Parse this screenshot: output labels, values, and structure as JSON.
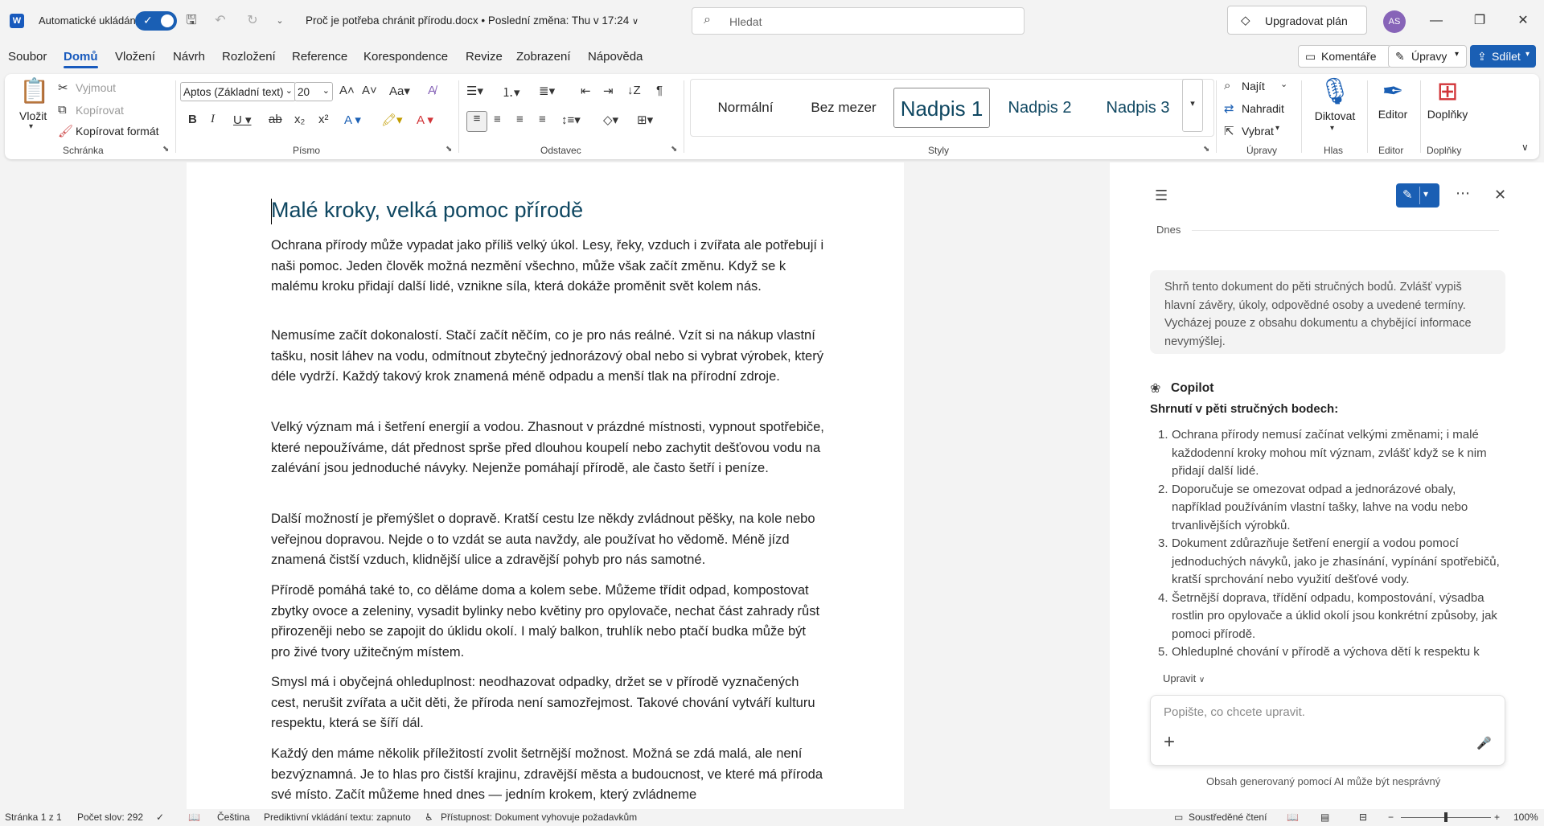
{
  "titlebar": {
    "autosave_label": "Automatické ukládání",
    "doc_title": "Proč je potřeba chránit přírodu.docx • Poslední změna: Thu v 17:24",
    "search_placeholder": "Hledat",
    "upgrade_label": "Upgradovat plán",
    "avatar_initials": "AS"
  },
  "menu": {
    "tabs": [
      "Soubor",
      "Domů",
      "Vložení",
      "Návrh",
      "Rozložení",
      "Reference",
      "Korespondence",
      "Revize",
      "Zobrazení",
      "Nápověda"
    ],
    "comments_label": "Komentáře",
    "edits_label": "Úpravy",
    "share_label": "Sdílet"
  },
  "ribbon": {
    "clipboard": {
      "paste": "Vložit",
      "cut": "Vyjmout",
      "copy": "Kopírovat",
      "format_painter": "Kopírovat formát",
      "label": "Schránka"
    },
    "font": {
      "family": "Aptos (Základní text)",
      "size": "20",
      "label": "Písmo"
    },
    "paragraph": {
      "label": "Odstavec"
    },
    "styles": {
      "items": [
        "Normální",
        "Bez mezer",
        "Nadpis 1",
        "Nadpis 2",
        "Nadpis 3"
      ],
      "label": "Styly"
    },
    "editing": {
      "find": "Najít",
      "replace": "Nahradit",
      "select": "Vybrat",
      "label": "Úpravy"
    },
    "voice": {
      "dictate": "Diktovat",
      "label": "Hlas"
    },
    "editor": {
      "button": "Editor",
      "label": "Editor"
    },
    "addins": {
      "button": "Doplňky",
      "label": "Doplňky"
    }
  },
  "document": {
    "heading": "Malé kroky, velká pomoc přírodě",
    "paragraphs": [
      "Ochrana přírody může vypadat jako příliš velký úkol. Lesy, řeky, vzduch i zvířata ale potřebují i naši pomoc. Jeden člověk možná nezmění všechno, může však začít změnu. Když se k malému kroku přidají další lidé, vznikne síla, která dokáže proměnit svět kolem nás.",
      "Nemusíme začít dokonalostí. Stačí začít něčím, co je pro nás reálné. Vzít si na nákup vlastní tašku, nosit láhev na vodu, odmítnout zbytečný jednorázový obal nebo si vybrat výrobek, který déle vydrží. Každý takový krok znamená méně odpadu a menší tlak na přírodní zdroje.",
      "Velký význam má i šetření energií a vodou. Zhasnout v prázdné místnosti, vypnout spotřebiče, které nepoužíváme, dát přednost sprše před dlouhou koupelí nebo zachytit dešťovou vodu na zalévání jsou jednoduché návyky. Nejenže pomáhají přírodě, ale často šetří i peníze.",
      "Další možností je přemýšlet o dopravě. Kratší cestu lze někdy zvládnout pěšky, na kole nebo veřejnou dopravou. Nejde o to vzdát se auta navždy, ale používat ho vědomě. Méně jízd znamená čistší vzduch, klidnější ulice a zdravější pohyb pro nás samotné.",
      "Přírodě pomáhá také to, co děláme doma a kolem sebe. Můžeme třídit odpad, kompostovat zbytky ovoce a zeleniny, vysadit bylinky nebo květiny pro opylovače, nechat část zahrady růst přirozeněji nebo se zapojit do úklidu okolí. I malý balkon, truhlík nebo ptačí budka může být pro živé tvory užitečným místem.",
      "Smysl má i obyčejná ohleduplnost: neodhazovat odpadky, držet se v přírodě vyznačených cest, nerušit zvířata a učit děti, že příroda není samozřejmost. Takové chování vytváří kulturu respektu, která se šíří dál.",
      "Každý den máme několik příležitostí zvolit šetrnější možnost. Možná se zdá malá, ale není bezvýznamná. Je to hlas pro čistší krajinu, zdravější města a budoucnost, ve které má příroda své místo. Začít můžeme hned dnes — jedním krokem, který zvládneme"
    ]
  },
  "copilot": {
    "today": "Dnes",
    "user_prompt": "Shrň tento dokument do pěti stručných bodů. Zvlášť vypiš hlavní závěry, úkoly, odpovědné osoby a uvedené termíny. Vycházej pouze z obsahu dokumentu a chybějící informace nevymýšlej.",
    "name": "Copilot",
    "summary_title": "Shrnutí v pěti stručných bodech:",
    "summary_items": [
      "Ochrana přírody nemusí začínat velkými změnami; i malé každodenní kroky mohou mít význam, zvlášť když se k nim přidají další lidé.",
      "Doporučuje se omezovat odpad a jednorázové obaly, například používáním vlastní tašky, lahve na vodu nebo trvanlivějších výrobků.",
      "Dokument zdůrazňuje šetření energií a vodou pomocí jednoduchých návyků, jako je zhasínání, vypínání spotřebičů, kratší sprchování nebo využití dešťové vody.",
      "Šetrnější doprava, třídění odpadu, kompostování, výsadba rostlin pro opylovače a úklid okolí jsou konkrétní způsoby, jak pomoci přírodě.",
      "Ohleduplné chování v přírodě a výchova dětí k respektu k"
    ],
    "edit_label": "Upravit",
    "input_placeholder": "Popište, co chcete upravit.",
    "disclaimer": "Obsah generovaný pomocí AI může být nesprávný"
  },
  "status": {
    "page": "Stránka 1 z 1",
    "words": "Počet slov: 292",
    "language": "Čeština",
    "predictive": "Prediktivní vkládání textu: zapnuto",
    "accessibility": "Přístupnost: Dokument vyhovuje požadavkům",
    "focus": "Soustředěné čtení",
    "zoom": "100%"
  },
  "colors": {
    "accent": "#185abd",
    "heading": "#0f4761"
  }
}
